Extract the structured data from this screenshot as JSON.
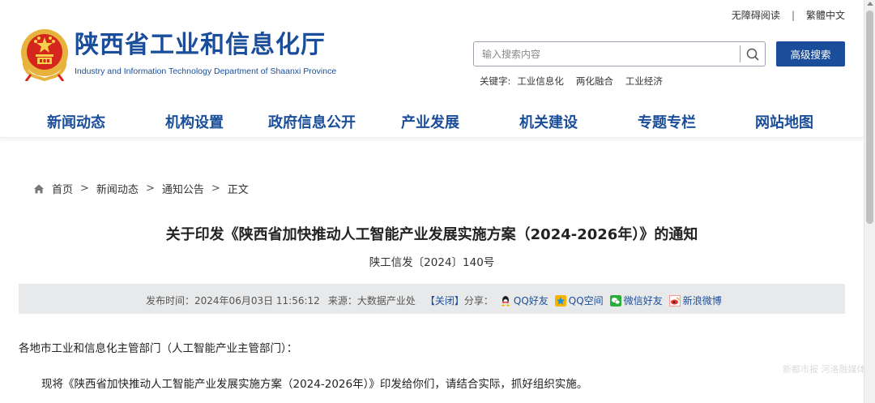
{
  "topbar": {
    "accessibility": "无障碍阅读",
    "separator": "|",
    "language": "繁體中文"
  },
  "header": {
    "title": "陕西省工业和信息化厅",
    "subtitle": "Industry and Information Technology Department of Shaanxi Province"
  },
  "search": {
    "placeholder": "输入搜索内容",
    "advanced_label": "高级搜索"
  },
  "keywords": {
    "label": "关键字:",
    "items": [
      "工业信息化",
      "两化融合",
      "工业经济"
    ]
  },
  "nav": {
    "items": [
      "新闻动态",
      "机构设置",
      "政府信息公开",
      "产业发展",
      "机关建设",
      "专题专栏",
      "网站地图"
    ]
  },
  "breadcrumb": {
    "items": [
      "首页",
      "新闻动态",
      "通知公告",
      "正文"
    ],
    "separator": ">"
  },
  "article": {
    "title": "关于印发《陕西省加快推动人工智能产业发展实施方案（2024-2026年）》的通知",
    "doc_number": "陕工信发〔2024〕140号",
    "publish_label": "发布时间：",
    "publish_time": "2024年06月03日 11:56:12",
    "source_label": "来源：",
    "source": "大数据产业处",
    "close_label": "【关闭】",
    "share_label": "分享：",
    "share": [
      "QQ好友",
      "QQ空间",
      "微信好友",
      "新浪微博"
    ],
    "salutation": "各地市工业和信息化主管部门（人工智能产业主管部门）：",
    "body": "现将《陕西省加快推动人工智能产业发展实施方案（2024-2026年）》印发给你们，请结合实际，抓好组织实施。"
  },
  "watermark": "新都市报 河洛融媒体",
  "colors": {
    "brand_blue": "#1a4e9a",
    "meta_bg": "#e8e9ea"
  }
}
